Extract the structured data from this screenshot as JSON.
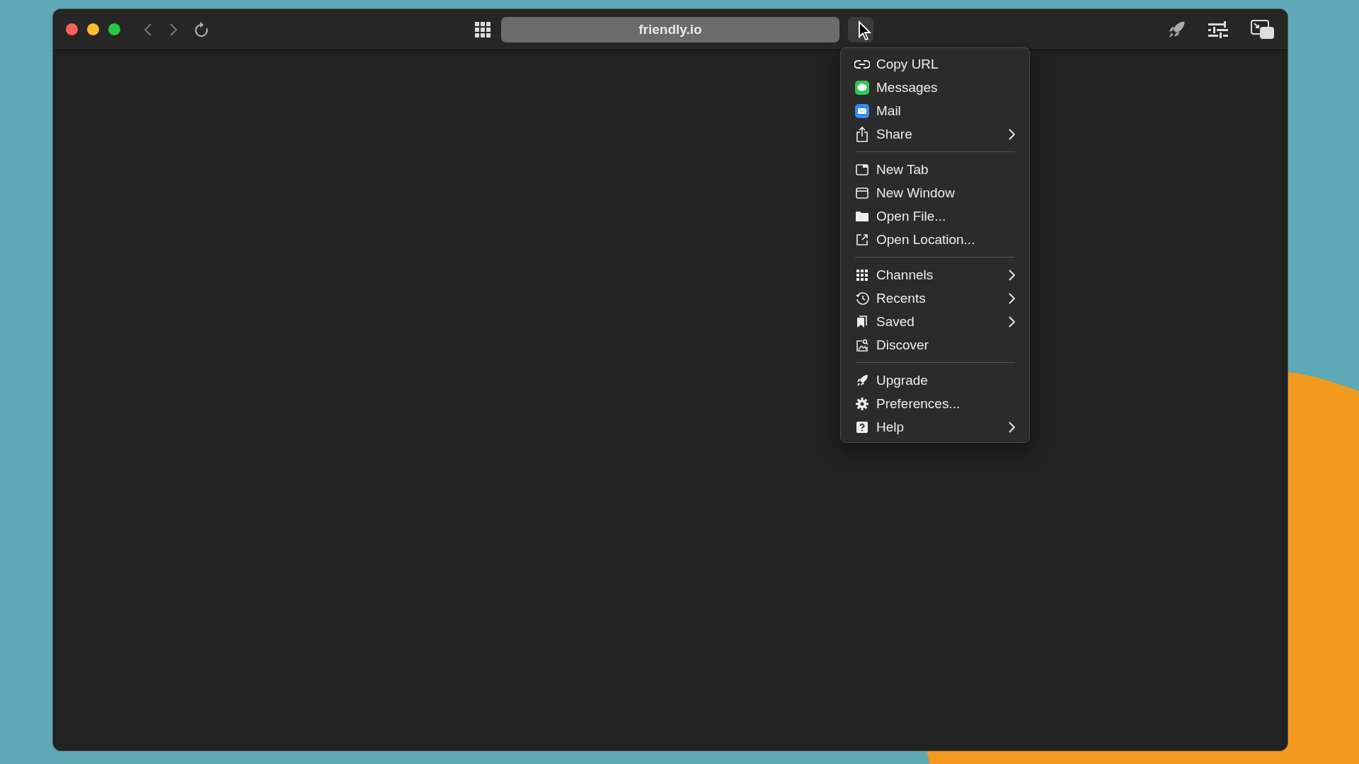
{
  "window": {
    "url": "friendly.io"
  },
  "menu": {
    "sections": [
      {
        "items": [
          {
            "label": "Copy URL",
            "submenu": false
          },
          {
            "label": "Messages",
            "submenu": false
          },
          {
            "label": "Mail",
            "submenu": false
          },
          {
            "label": "Share",
            "submenu": true
          }
        ]
      },
      {
        "items": [
          {
            "label": "New Tab",
            "submenu": false
          },
          {
            "label": "New Window",
            "submenu": false
          },
          {
            "label": "Open File...",
            "submenu": false
          },
          {
            "label": "Open Location...",
            "submenu": false
          }
        ]
      },
      {
        "items": [
          {
            "label": "Channels",
            "submenu": true
          },
          {
            "label": "Recents",
            "submenu": true
          },
          {
            "label": "Saved",
            "submenu": true
          },
          {
            "label": "Discover",
            "submenu": false
          }
        ]
      },
      {
        "items": [
          {
            "label": "Upgrade",
            "submenu": false
          },
          {
            "label": "Preferences...",
            "submenu": false
          },
          {
            "label": "Help",
            "submenu": true
          }
        ]
      }
    ]
  }
}
